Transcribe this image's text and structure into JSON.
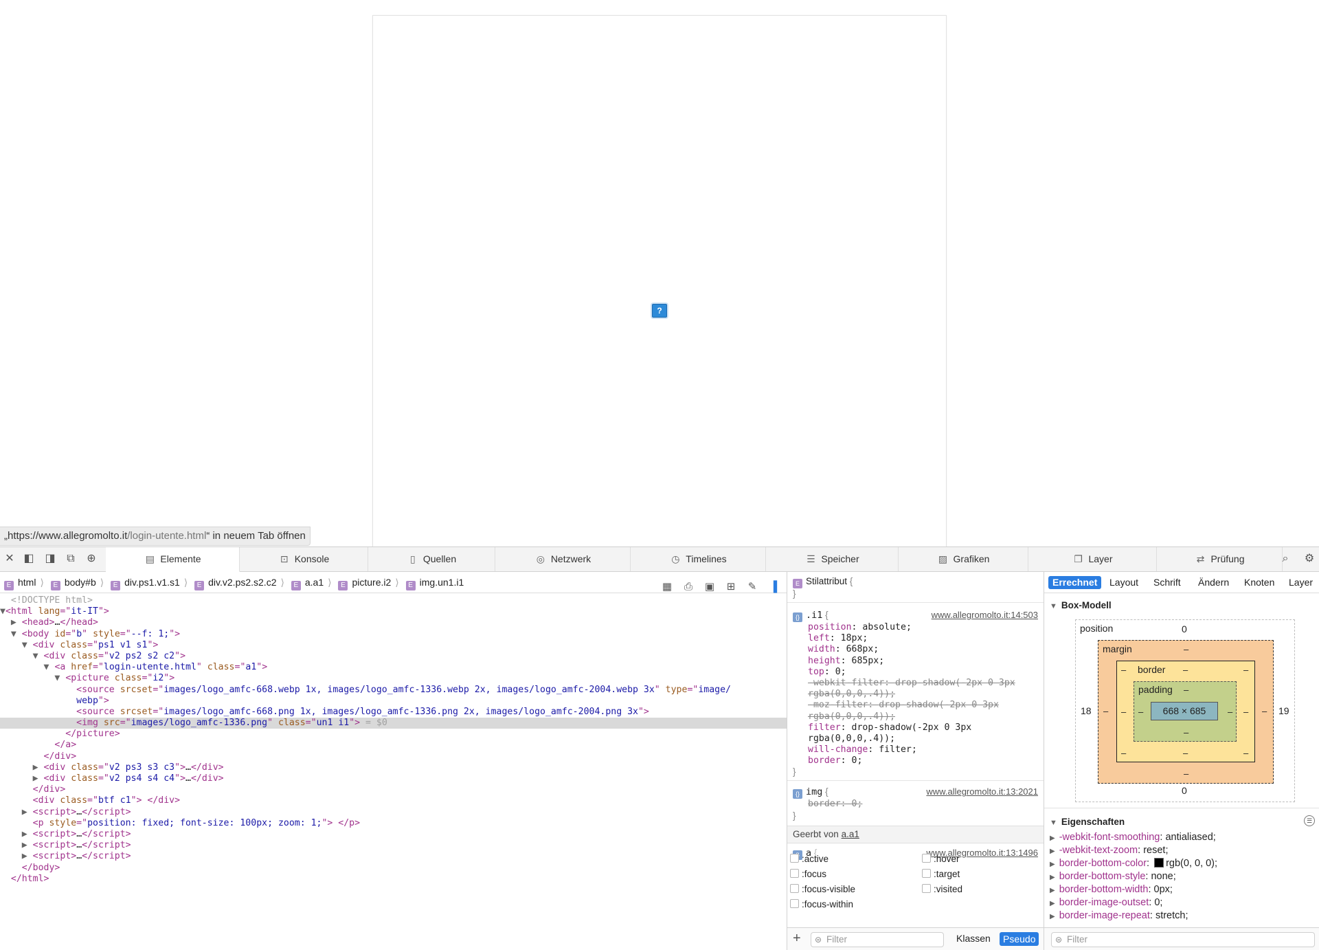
{
  "status_bar": {
    "link_prefix": "„https://www.allegromolto.it",
    "link_path": "/login-utente.html",
    "link_suffix": "“ in neuem Tab öffnen"
  },
  "page": {
    "broken_image_glyph": "?"
  },
  "devtools": {
    "tabs": [
      {
        "label": "Elemente",
        "icon": "elements-icon"
      },
      {
        "label": "Konsole",
        "icon": "console-icon"
      },
      {
        "label": "Quellen",
        "icon": "sources-icon"
      },
      {
        "label": "Netzwerk",
        "icon": "network-icon"
      },
      {
        "label": "Timelines",
        "icon": "timelines-icon"
      },
      {
        "label": "Speicher",
        "icon": "storage-icon"
      },
      {
        "label": "Grafiken",
        "icon": "graphics-icon"
      },
      {
        "label": "Layer",
        "icon": "layers-icon"
      },
      {
        "label": "Prüfung",
        "icon": "audit-icon"
      }
    ],
    "active_tab": "Elemente",
    "breadcrumb": [
      "html",
      "body#b",
      "div.ps1.v1.s1",
      "div.v2.ps2.s2.c2",
      "a.a1",
      "picture.i2",
      "img.un1.i1"
    ],
    "dom": {
      "doctype": "<!DOCTYPE html>",
      "html_lang": "it-IT",
      "body_id": "b",
      "body_style": "--f: 1;",
      "div1_class": "ps1 v1 s1",
      "div2_class": "v2 ps2 s2 c2",
      "a_href": "login-utente.html",
      "a_class": "a1",
      "picture_class": "i2",
      "source1_srcset": "images/logo_amfc-668.webp 1x, images/logo_amfc-1336.webp 2x, images/logo_amfc-2004.webp 3x",
      "source1_type_a": "image/",
      "source1_type_b": "webp",
      "source2_srcset": "images/logo_amfc-668.png 1x, images/logo_amfc-1336.png 2x, images/logo_amfc-2004.png 3x",
      "img_src": "images/logo_amfc-1336.png",
      "img_class": "un1 i1",
      "img_suffix": " = $0",
      "div3_class": "v2 ps3 s3 c3",
      "div4_class": "v2 ps4 s4 c4",
      "div5_class": "btf c1",
      "p_style": "position: fixed; font-size: 100px; zoom: 1;"
    },
    "styles": {
      "stilattribut": "Stilattribut",
      "rule1": {
        "selector": ".i1",
        "source": "www.allegromolto.it:14:503",
        "props": [
          {
            "name": "position",
            "value": "absolute",
            "struck": false
          },
          {
            "name": "left",
            "value": "18px",
            "struck": false
          },
          {
            "name": "width",
            "value": "668px",
            "struck": false
          },
          {
            "name": "height",
            "value": "685px",
            "struck": false
          },
          {
            "name": "top",
            "value": "0",
            "struck": false
          },
          {
            "name": "-webkit-filter",
            "value": "drop-shadow(-2px 0 3px",
            "struck": true
          },
          {
            "name": "",
            "value": "rgba(0,0,0,.4));",
            "struck": true
          },
          {
            "name": "-moz-filter",
            "value": "drop-shadow(-2px 0 3px",
            "struck": true
          },
          {
            "name": "",
            "value": "rgba(0,0,0,.4));",
            "struck": true
          },
          {
            "name": "filter",
            "value": "drop-shadow(-2px 0 3px",
            "struck": false
          },
          {
            "name": "",
            "value": "rgba(0,0,0,.4));",
            "struck": false
          },
          {
            "name": "will-change",
            "value": "filter",
            "struck": false
          },
          {
            "name": "border",
            "value": "0",
            "struck": false
          }
        ]
      },
      "rule2": {
        "selector": "img",
        "source": "www.allegromolto.it:13:2021",
        "prop_name": "border",
        "prop_value": "0"
      },
      "inherited_label": "Geerbt von",
      "inherited_from": "a.a1",
      "rule3": {
        "selector": "a",
        "source": "www.allegromolto.it:13:1496"
      },
      "pseudo": [
        ":active",
        ":hover",
        ":focus",
        ":target",
        ":focus-visible",
        ":visited",
        ":focus-within"
      ],
      "filter_placeholder": "Filter",
      "klassen": "Klassen",
      "pseudo_btn": "Pseudo"
    },
    "computed": {
      "tabs": [
        "Errechnet",
        "Layout",
        "Schrift",
        "Ändern",
        "Knoten",
        "Layer"
      ],
      "active": "Errechnet",
      "boxmodel_title": "Box-Modell",
      "boxmodel": {
        "position_label": "position",
        "position_top": "0",
        "position_bottom": "0",
        "position_left": "18",
        "position_right": "19",
        "margin_label": "margin",
        "border_label": "border",
        "padding_label": "padding",
        "dash": "–",
        "content": "668 × 685"
      },
      "props_title": "Eigenschaften",
      "props": [
        {
          "name": "-webkit-font-smoothing",
          "value": "antialiased"
        },
        {
          "name": "-webkit-text-zoom",
          "value": "reset"
        },
        {
          "name": "border-bottom-color",
          "value": "rgb(0, 0, 0)"
        },
        {
          "name": "border-bottom-style",
          "value": "none"
        },
        {
          "name": "border-bottom-width",
          "value": "0px"
        },
        {
          "name": "border-image-outset",
          "value": "0"
        },
        {
          "name": "border-image-repeat",
          "value": "stretch"
        }
      ],
      "filter_placeholder": "Filter"
    }
  },
  "colors": {
    "accent": "#2a7de1",
    "tag": "#a0328c",
    "attr": "#9a5b20",
    "value": "#1b1aa7",
    "margin": "#f8cb9c",
    "border": "#fde39a",
    "padding": "#c3d08b",
    "content": "#8cb6c0"
  }
}
